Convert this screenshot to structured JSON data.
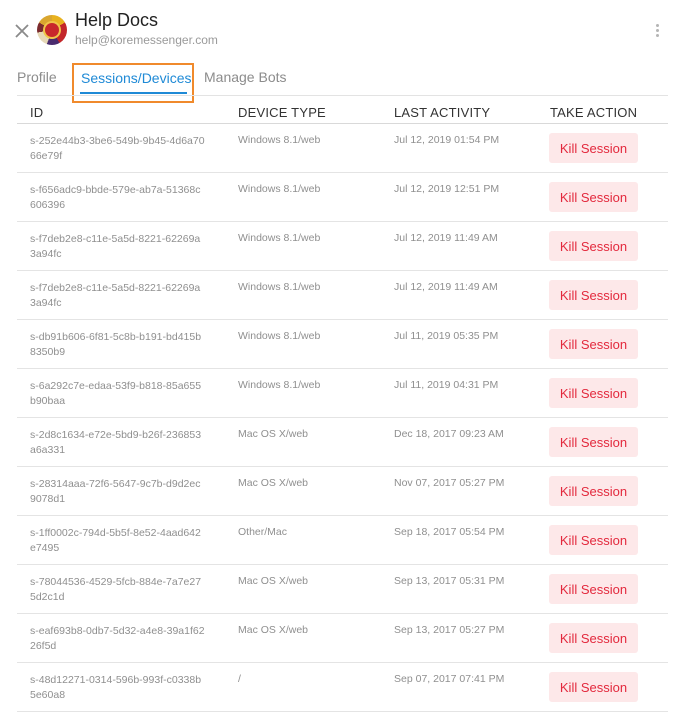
{
  "header": {
    "title": "Help Docs",
    "email": "help@koremessenger.com"
  },
  "tabs": [
    {
      "label": "Profile",
      "active": false
    },
    {
      "label": "Sessions/Devices",
      "active": true
    },
    {
      "label": "Manage Bots",
      "active": false
    }
  ],
  "table": {
    "columns": [
      "ID",
      "DEVICE TYPE",
      "LAST ACTIVITY",
      "TAKE ACTION"
    ],
    "action_label": "Kill Session",
    "rows": [
      {
        "id": "s-252e44b3-3be6-549b-9b45-4d6a7066e79f",
        "device": "Windows 8.1/web",
        "activity": "Jul 12, 2019 01:54 PM"
      },
      {
        "id": "s-f656adc9-bbde-579e-ab7a-51368c606396",
        "device": "Windows 8.1/web",
        "activity": "Jul 12, 2019 12:51 PM"
      },
      {
        "id": "s-f7deb2e8-c11e-5a5d-8221-62269a3a94fc",
        "device": "Windows 8.1/web",
        "activity": "Jul 12, 2019 11:49 AM"
      },
      {
        "id": "s-f7deb2e8-c11e-5a5d-8221-62269a3a94fc",
        "device": "Windows 8.1/web",
        "activity": "Jul 12, 2019 11:49 AM"
      },
      {
        "id": "s-db91b606-6f81-5c8b-b191-bd415b8350b9",
        "device": "Windows 8.1/web",
        "activity": "Jul 11, 2019 05:35 PM"
      },
      {
        "id": "s-6a292c7e-edaa-53f9-b818-85a655b90baa",
        "device": "Windows 8.1/web",
        "activity": "Jul 11, 2019 04:31 PM"
      },
      {
        "id": "s-2d8c1634-e72e-5bd9-b26f-236853a6a331",
        "device": "Mac OS X/web",
        "activity": "Dec 18, 2017 09:23 AM"
      },
      {
        "id": "s-28314aaa-72f6-5647-9c7b-d9d2ec9078d1",
        "device": "Mac OS X/web",
        "activity": "Nov 07, 2017 05:27 PM"
      },
      {
        "id": "s-1ff0002c-794d-5b5f-8e52-4aad642e7495",
        "device": "Other/Mac",
        "activity": "Sep 18, 2017 05:54 PM"
      },
      {
        "id": "s-78044536-4529-5fcb-884e-7a7e275d2c1d",
        "device": "Mac OS X/web",
        "activity": "Sep 13, 2017 05:31 PM"
      },
      {
        "id": "s-eaf693b8-0db7-5d32-a4e8-39a1f6226f5d",
        "device": "Mac OS X/web",
        "activity": "Sep 13, 2017 05:27 PM"
      },
      {
        "id": "s-48d12271-0314-596b-993f-c0338b5e60a8",
        "device": "/",
        "activity": "Sep 07, 2017 07:41 PM"
      }
    ]
  },
  "colors": {
    "accent": "#1f8ad6",
    "highlight_border": "#f08a2c",
    "kill_text": "#e3293d",
    "kill_bg": "#fde8e9"
  }
}
